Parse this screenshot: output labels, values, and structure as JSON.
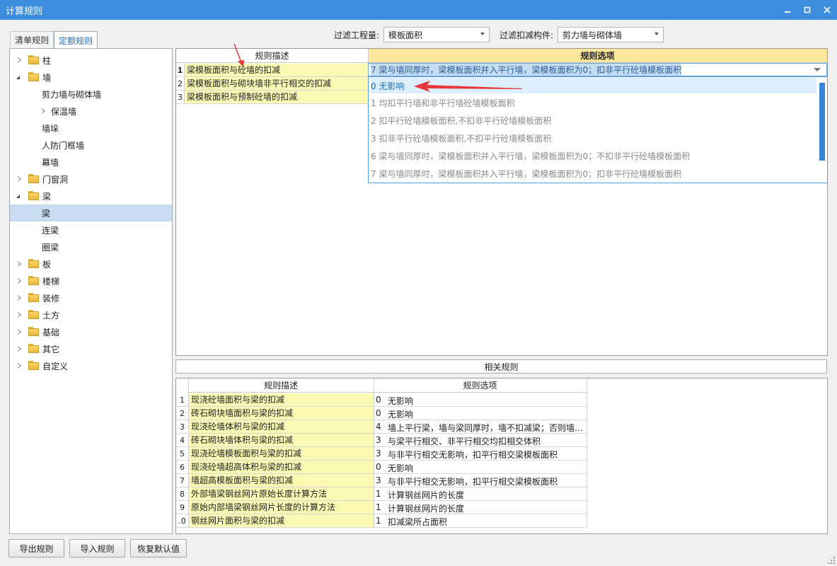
{
  "window": {
    "title": "计算规则",
    "minimize": "–",
    "maximize": "□",
    "close": "✕"
  },
  "tabs": [
    {
      "label": "清单规则"
    },
    {
      "label": "定额规则"
    }
  ],
  "filters": {
    "quantity_label": "过滤工程量:",
    "quantity_value": "模板面积",
    "member_label": "过滤扣减构件:",
    "member_value": "剪力墙与砌体墙"
  },
  "tree": [
    {
      "label": "柱",
      "level": 1,
      "expander": "closed",
      "folder": true
    },
    {
      "label": "墙",
      "level": 1,
      "expander": "open",
      "folder": true
    },
    {
      "label": "剪力墙与砌体墙",
      "level": 2
    },
    {
      "label": "保温墙",
      "level": 2,
      "expander": "closed"
    },
    {
      "label": "墙垛",
      "level": 2
    },
    {
      "label": "人防门框墙",
      "level": 2
    },
    {
      "label": "幕墙",
      "level": 2
    },
    {
      "label": "门窗洞",
      "level": 1,
      "expander": "closed",
      "folder": true
    },
    {
      "label": "梁",
      "level": 1,
      "expander": "open",
      "folder": true
    },
    {
      "label": "梁",
      "level": 2,
      "selected": true
    },
    {
      "label": "连梁",
      "level": 2
    },
    {
      "label": "圈梁",
      "level": 2
    },
    {
      "label": "板",
      "level": 1,
      "expander": "closed",
      "folder": true
    },
    {
      "label": "楼梯",
      "level": 1,
      "expander": "closed",
      "folder": true
    },
    {
      "label": "装修",
      "level": 1,
      "expander": "closed",
      "folder": true
    },
    {
      "label": "土方",
      "level": 1,
      "expander": "closed",
      "folder": true
    },
    {
      "label": "基础",
      "level": 1,
      "expander": "closed",
      "folder": true
    },
    {
      "label": "其它",
      "level": 1,
      "expander": "closed",
      "folder": true
    },
    {
      "label": "自定义",
      "level": 1,
      "expander": "closed",
      "folder": true
    }
  ],
  "rules": {
    "col_desc": "规则描述",
    "col_option": "规则选项",
    "rows": [
      {
        "num": "1",
        "desc": "梁模板面积与砼墙的扣减"
      },
      {
        "num": "2",
        "desc": "梁模板面积与砌块墙非平行相交的扣减"
      },
      {
        "num": "3",
        "desc": "梁模板面积与预制砼墙的扣减"
      }
    ],
    "edit_value": "7 梁与墙同厚时，梁模板面积并入平行墙，梁模板面积为0；扣非平行砼墙模板面积",
    "options": [
      "0  无影响",
      "1 均扣平行墙和非平行墙砼墙模板面积",
      "2 扣平行砼墙模板面积,不扣非平行砼墙模板面积",
      "3 扣非平行砼墙模板面积,不扣平行砼墙模板面积",
      "6 梁与墙同厚时，梁模板面积并入平行墙，梁模板面积为0；不扣非平行砼墙模板面积",
      "7 梁与墙同厚时，梁模板面积并入平行墙，梁模板面积为0；扣非平行砼墙模板面积"
    ]
  },
  "related": {
    "title": "相关规则",
    "col_desc": "规则描述",
    "col_option": "规则选项",
    "rows": [
      {
        "num": "1",
        "desc": "现浇砼墙面积与梁的扣减",
        "code": "0",
        "option": "无影响"
      },
      {
        "num": "2",
        "desc": "砖石砌块墙面积与梁的扣减",
        "code": "0",
        "option": "无影响"
      },
      {
        "num": "3",
        "desc": "现浇砼墙体积与梁的扣减",
        "code": "4",
        "option": "墙上平行梁，墙与梁同厚时，墙不扣减梁；否则墙…"
      },
      {
        "num": "4",
        "desc": "砖石砌块墙体积与梁的扣减",
        "code": "3",
        "option": "与梁平行相交、非平行相交均扣相交体积"
      },
      {
        "num": "5",
        "desc": "现浇砼墙模板面积与梁的扣减",
        "code": "3",
        "option": "与非平行相交无影响，扣平行相交梁模板面积"
      },
      {
        "num": "6",
        "desc": "现浇砼墙超高体积与梁的扣减",
        "code": "0",
        "option": "无影响"
      },
      {
        "num": "7",
        "desc": "墙超高模板面积与梁的扣减",
        "code": "3",
        "option": "与非平行相交无影响，扣平行相交梁模板面积"
      },
      {
        "num": "8",
        "desc": "外部墙梁钢丝网片原始长度计算方法",
        "code": "1",
        "option": "计算钢丝网片的长度"
      },
      {
        "num": "9",
        "desc": "原始内部墙梁钢丝网片长度的计算方法",
        "code": "1",
        "option": "计算钢丝网片的长度"
      },
      {
        "num": ".0",
        "desc": "钢丝网片面积与梁的扣减",
        "code": "1",
        "option": "扣减梁所占面积"
      }
    ]
  },
  "buttons": {
    "export": "导出规则",
    "import": "导入规则",
    "restore": "恢复默认值"
  },
  "colors": {
    "titlebar": "#3e8ede",
    "desc_cell": "#fafab4",
    "option_header": "#fbe79b",
    "selection": "#c9ddf2",
    "annotation_arrow": "#e8383b"
  }
}
